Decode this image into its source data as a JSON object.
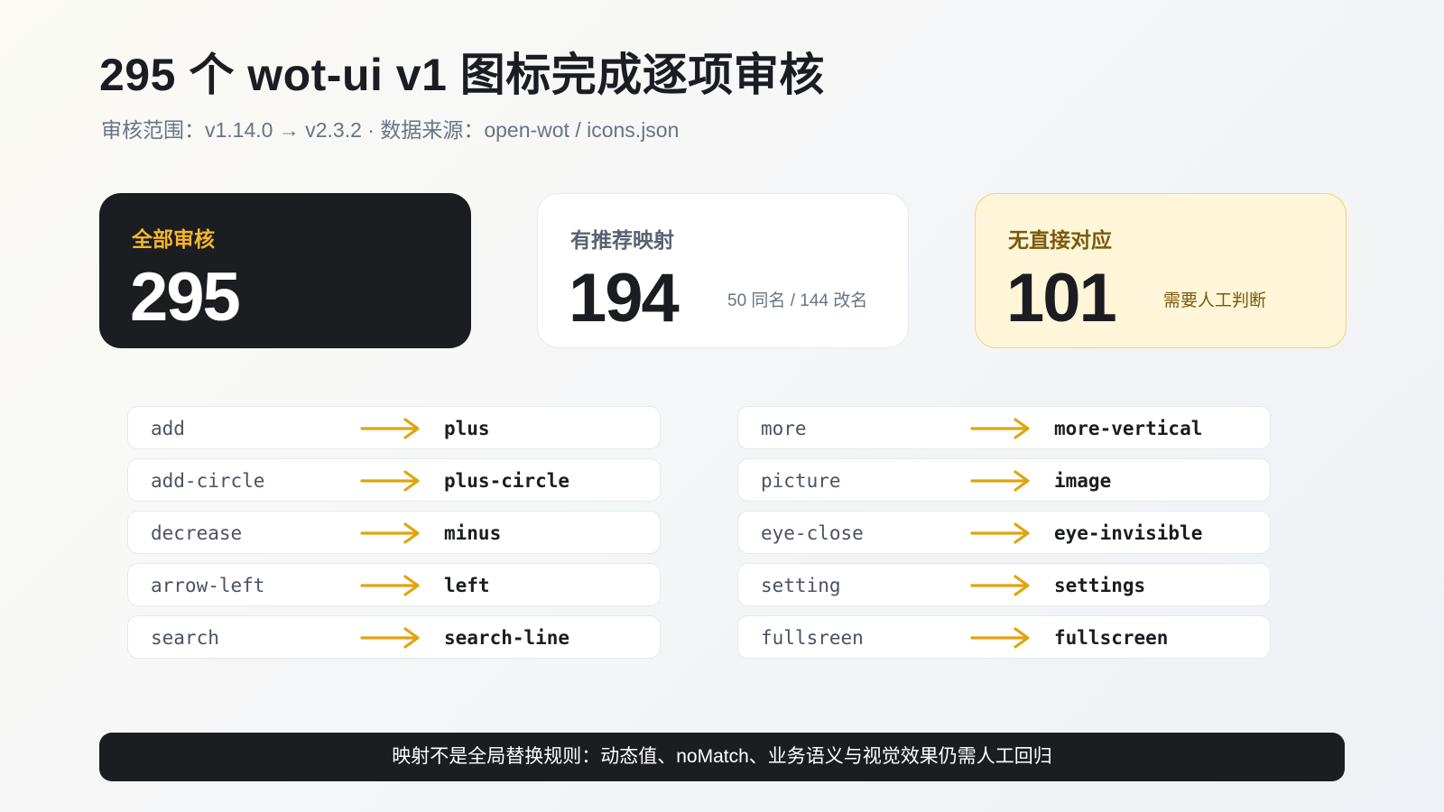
{
  "header": {
    "title": "295 个 wot-ui v1 图标完成逐项审核",
    "subtitle": "审核范围：v1.14.0 → v2.3.2 · 数据来源：open-wot / icons.json"
  },
  "stats": {
    "total": {
      "label": "全部审核",
      "value": "295"
    },
    "mapped": {
      "label": "有推荐映射",
      "value": "194",
      "note": "50 同名 / 144 改名"
    },
    "no_match": {
      "label": "无直接对应",
      "value": "101",
      "note": "需要人工判断"
    }
  },
  "mappings": {
    "left": [
      {
        "from": "add",
        "to": "plus"
      },
      {
        "from": "add-circle",
        "to": "plus-circle"
      },
      {
        "from": "decrease",
        "to": "minus"
      },
      {
        "from": "arrow-left",
        "to": "left"
      },
      {
        "from": "search",
        "to": "search-line"
      }
    ],
    "right": [
      {
        "from": "more",
        "to": "more-vertical"
      },
      {
        "from": "picture",
        "to": "image"
      },
      {
        "from": "eye-close",
        "to": "eye-invisible"
      },
      {
        "from": "setting",
        "to": "settings"
      },
      {
        "from": "fullsreen",
        "to": "fullscreen"
      }
    ],
    "arrow_icon": "arrow-right-icon",
    "arrow_color": "#e0a410"
  },
  "footer": {
    "text": "映射不是全局替换规则：动态值、noMatch、业务语义与视觉效果仍需人工回归"
  },
  "colors": {
    "accent": "#f3b62a",
    "dark_card": "#1c1d21",
    "warning_bg": "#fff5d9",
    "warning_border": "#f2d37a",
    "warning_text": "#7a5a0a"
  }
}
